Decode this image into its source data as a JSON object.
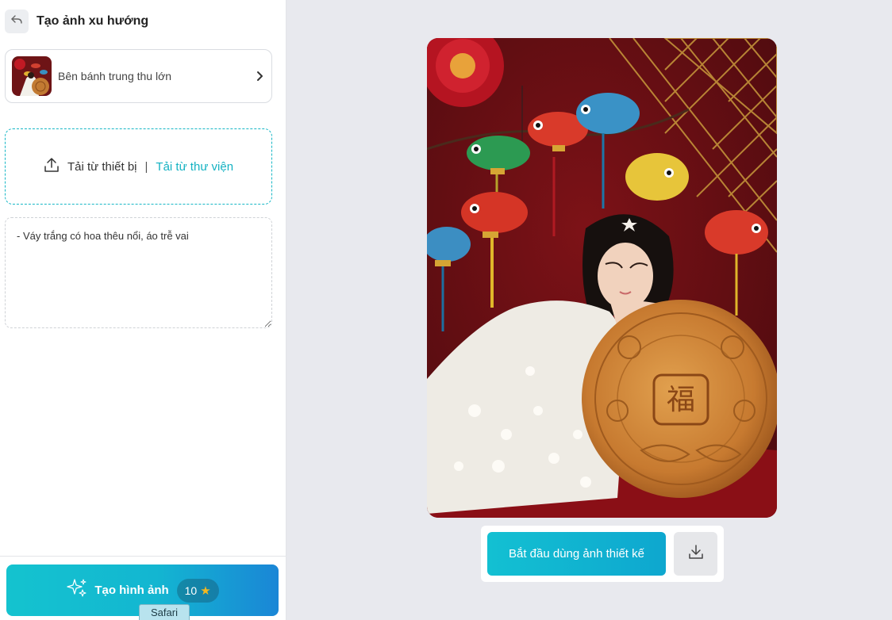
{
  "header": {
    "title": "Tạo ảnh xu hướng",
    "back_icon": "back-arrow-icon"
  },
  "template": {
    "label": "Bên bánh trung thu lớn",
    "chevron_icon": "chevron-right-icon"
  },
  "upload": {
    "device_label": "Tải từ thiết bị",
    "separator": "|",
    "library_label": "Tải từ thư viện",
    "icon": "upload-icon"
  },
  "prompt": {
    "value": "- Váy trắng có hoa thêu nổi, áo trễ vai"
  },
  "generate": {
    "label": "Tạo hình ảnh",
    "credits": "10",
    "icon": "sparkles-icon",
    "credit_icon": "star-icon"
  },
  "preview": {
    "use_label": "Bắt đầu dùng ảnh thiết kế",
    "download_icon": "download-icon"
  },
  "taskbar": {
    "safari_label": "Safari"
  },
  "colors": {
    "accent": "#14b2c2",
    "background": "#e8e9ee"
  }
}
